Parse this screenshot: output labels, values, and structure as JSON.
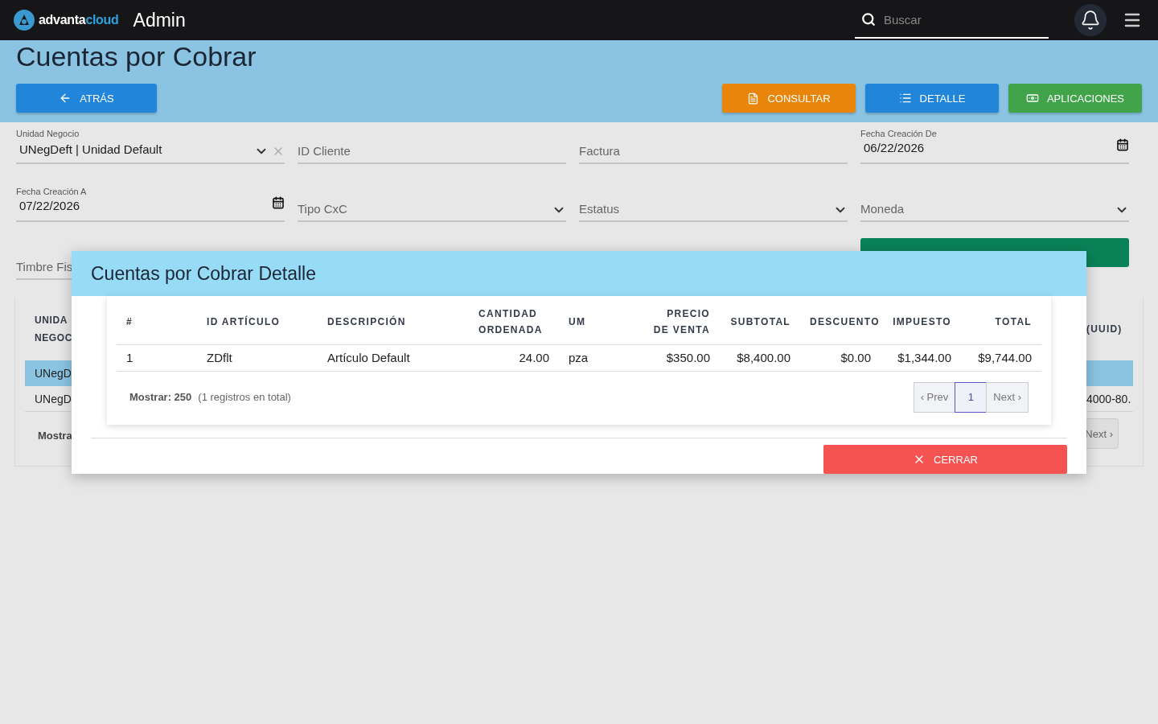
{
  "header": {
    "logo": {
      "part_1": "advanta",
      "part_2": "cloud"
    },
    "app_name": "Admin",
    "search": {
      "placeholder": "Buscar"
    }
  },
  "page": {
    "title": "Cuentas por Cobrar",
    "actions": [
      {
        "label": "ATRÁS",
        "kind": "back"
      },
      {
        "label": "CONSULTAR",
        "kind": "consult"
      },
      {
        "label": "DETALLE",
        "kind": "detail"
      },
      {
        "label": "APLICACIONES",
        "kind": "apps"
      }
    ]
  },
  "filters": [
    {
      "kind": "select",
      "label": "Unidad Negocio",
      "value": "UNegDeft | Unidad Default",
      "clearable": true
    },
    {
      "kind": "text",
      "placeholder": "ID Cliente"
    },
    {
      "kind": "text",
      "placeholder": "Factura"
    },
    {
      "kind": "date",
      "label": "Fecha Creación De",
      "value": "06/22/2026"
    },
    {
      "kind": "date",
      "label": "Fecha Creación A",
      "value": "07/22/2026"
    },
    {
      "kind": "select",
      "placeholder": "Tipo CxC"
    },
    {
      "kind": "select",
      "placeholder": "Estatus"
    },
    {
      "kind": "select",
      "placeholder": "Moneda"
    },
    {
      "kind": "text",
      "placeholder": "Timbre Fis"
    },
    {
      "kind": "search_button"
    }
  ],
  "background_table": {
    "header_left": [
      "UNIDA",
      "NEGOC"
    ],
    "header_right": "(UUID)",
    "rows": [
      {
        "left": "UNegD",
        "right": "",
        "selected": true
      },
      {
        "left": "UNegD",
        "right": "4000-80.",
        "selected": false
      }
    ],
    "footer_left": "Mostra",
    "next": "Next ›"
  },
  "modal": {
    "title": "Cuentas por Cobrar Detalle",
    "columns": [
      {
        "lines": [
          "#"
        ]
      },
      {
        "lines": [
          "ID ARTÍCULO"
        ]
      },
      {
        "lines": [
          "DESCRIPCIÓN"
        ]
      },
      {
        "lines": [
          "CANTIDAD",
          "ORDENADA"
        ]
      },
      {
        "lines": [
          "UM"
        ]
      },
      {
        "lines": [
          "PRECIO",
          "DE VENTA"
        ]
      },
      {
        "lines": [
          "SUBTOTAL"
        ]
      },
      {
        "lines": [
          "DESCUENTO"
        ]
      },
      {
        "lines": [
          "IMPUESTO"
        ]
      },
      {
        "lines": [
          "TOTAL"
        ]
      }
    ],
    "rows": [
      [
        "1",
        "ZDflt",
        "Artículo Default",
        "24.00",
        "pza",
        "$350.00",
        "$8,400.00",
        "$0.00",
        "$1,344.00",
        "$9,744.00"
      ]
    ],
    "footer": {
      "page_size": "Mostrar: 250",
      "total": "(1 registros en total)",
      "pagination": {
        "prev": "‹ Prev",
        "pages": [
          {
            "label": "1",
            "selected": true
          }
        ],
        "next": "Next ›"
      }
    },
    "close": "CERRAR"
  }
}
